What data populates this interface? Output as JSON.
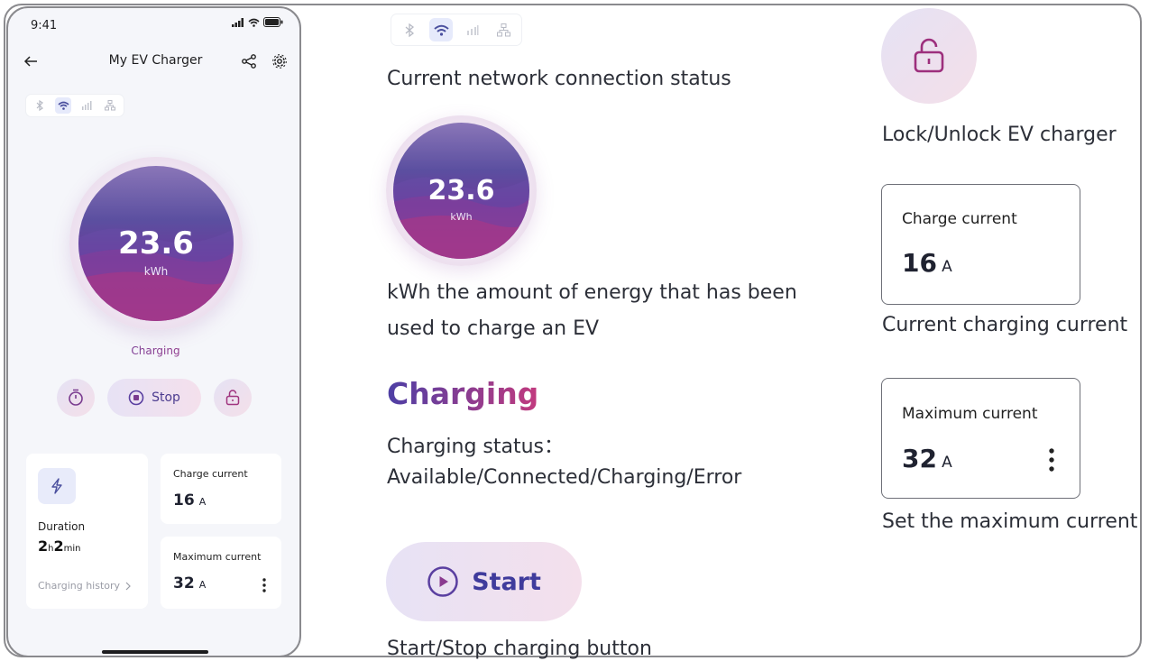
{
  "phone": {
    "status_time": "9:41",
    "title": "My EV Charger",
    "energy": {
      "value": "23.6",
      "unit": "kWh"
    },
    "status_text": "Charging",
    "stop_label": "Stop",
    "duration": {
      "label": "Duration",
      "hours": "2",
      "h_unit": "h",
      "minutes": "2",
      "m_unit": "min"
    },
    "history_link": "Charging history",
    "charge_current": {
      "label": "Charge current",
      "value": "16",
      "unit": "A"
    },
    "max_current": {
      "label": "Maximum current",
      "value": "32",
      "unit": "A"
    }
  },
  "annotations": {
    "network_caption": "Current network connection status",
    "energy": {
      "value": "23.6",
      "unit": "kWh"
    },
    "energy_caption_line1": "kWh the amount of energy that has been",
    "energy_caption_line2": "used to charge an EV",
    "status_heading": "Charging",
    "status_caption_line1": "Charging status：",
    "status_caption_line2": "Available/Connected/Charging/Error",
    "start_label": "Start",
    "start_caption": "Start/Stop charging button",
    "lock_caption": "Lock/Unlock EV charger",
    "charge_current": {
      "label": "Charge current",
      "value": "16",
      "unit": "A"
    },
    "charge_current_caption": "Current charging current",
    "max_current": {
      "label": "Maximum current",
      "value": "32",
      "unit": "A"
    },
    "max_current_caption": "Set the maximum current"
  },
  "icons": [
    "back-arrow-icon",
    "share-icon",
    "settings-gear-icon",
    "bluetooth-icon",
    "wifi-icon",
    "cellular-icon",
    "ethernet-icon",
    "timer-icon",
    "stop-icon",
    "unlock-icon",
    "lightning-icon",
    "chevron-right-icon",
    "more-vertical-icon",
    "play-icon"
  ],
  "colors": {
    "accent_purple": "#4d3fa5",
    "accent_magenta": "#c23a7e",
    "background": "#f5f6fa"
  }
}
